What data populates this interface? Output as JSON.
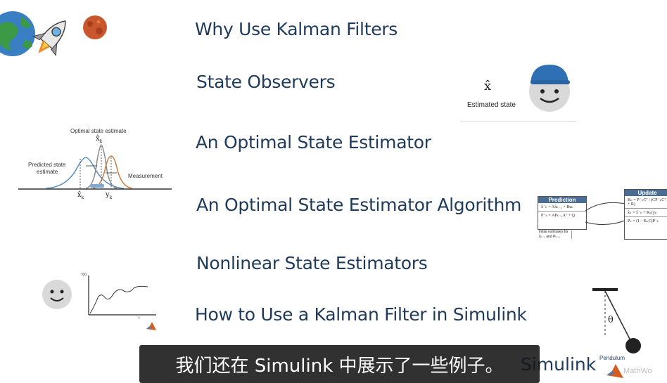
{
  "menu": {
    "items": [
      "Why Use Kalman Filters",
      "State Observers",
      "An Optimal State Estimator",
      "An Optimal State Estimator Algorithm",
      "Nonlinear State Estimators",
      "How to Use a Kalman Filter in Simulink"
    ],
    "partial_item": "Simulink"
  },
  "subtitle": "我们还在 Simulink 中展示了一些例子。",
  "observer": {
    "symbol": "x̂",
    "label": "Estimated state"
  },
  "gaussian_figure": {
    "title": "Optimal state estimate",
    "predicted_label_1": "Predicted state",
    "predicted_label_2": "estimate",
    "measurement_label": "Measurement",
    "xhat_top": "x̂",
    "xhat_top_sub": "k",
    "xhat_bottom": "x̂",
    "xhat_bottom_sub": "k",
    "y_label": "y",
    "y_sub": "k"
  },
  "algorithm": {
    "prediction_title": "Prediction",
    "prediction_eq_1": "x̂⁻ₖ = Ax̂ₖ₋₁ + Buₖ",
    "prediction_eq_2": "P⁻ₖ = APₖ₋₁Aᵀ + Q",
    "initial_1": "Initial estimates for",
    "initial_2": "x̂ₖ₋₁ and Pₖ₋₁",
    "update_title": "Update",
    "update_eq_1": "Kₖ = P⁻ₖCᵀ / (CP⁻ₖCᵀ + R)",
    "update_eq_2": "x̂ₖ = x̂⁻ₖ + Kₖ(yₖ",
    "update_eq_3": "Pₖ = (I − KₖC)P⁻ₖ"
  },
  "plot": {
    "y_axis_label": "f(x)",
    "x_axis_label": "t"
  },
  "pendulum": {
    "angle": "θ",
    "label": "Pendulum",
    "watermark": "MathWo"
  },
  "colors": {
    "text": "#1f3a5a",
    "blue_curve": "#5b8fc0",
    "orange_curve": "#c77a3f",
    "grey_curve": "#8a8a8a",
    "cap": "#2f6fb3",
    "face": "#d9d9d9",
    "header": "#4a6d93"
  }
}
